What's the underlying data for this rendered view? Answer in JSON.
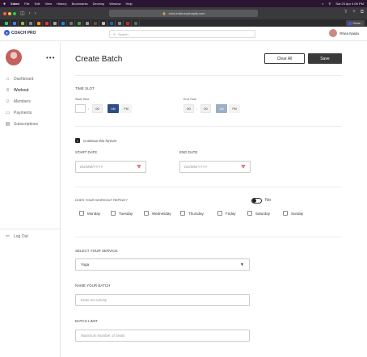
{
  "menubar": {
    "apple": "",
    "items": [
      "Safari",
      "File",
      "Edit",
      "View",
      "History",
      "Bookmarks",
      "Develop",
      "Window",
      "Help"
    ],
    "clock": "Sat 23 Apr  4:06 PM"
  },
  "browser": {
    "url": "shot-india.myshopify.com",
    "active_tab": "Home -",
    "colors": {
      "close": "#ff5f57",
      "min": "#febc2e",
      "max": "#28c840"
    }
  },
  "header": {
    "logo_text": "COACH PRO",
    "search_placeholder": "Search",
    "user_name": "Rhea Naidu"
  },
  "sidebar": {
    "menu_icon": "•••",
    "items": [
      {
        "label": "Dashboard",
        "icon": "home-icon",
        "glyph": "⌂"
      },
      {
        "label": "Workout",
        "icon": "workout-icon",
        "glyph": "≡"
      },
      {
        "label": "Members",
        "icon": "members-icon",
        "glyph": "☺"
      },
      {
        "label": "Payments",
        "icon": "payments-icon",
        "glyph": "▭"
      },
      {
        "label": "Subscriptions",
        "icon": "subscriptions-icon",
        "glyph": "▤"
      }
    ],
    "logout": {
      "label": "Log Out",
      "glyph": "⇦"
    }
  },
  "page": {
    "title": "Create Batch",
    "clear_label": "Clear All",
    "save_label": "Save"
  },
  "time_slot": {
    "heading": "TIME SLOT",
    "start": {
      "label": "Start Time",
      "hour": "",
      "minute": "00",
      "am": "AM",
      "pm": "PM"
    },
    "end": {
      "label": "End Time",
      "hour": "00",
      "minute": "00",
      "am": "AM",
      "pm": "PM"
    }
  },
  "continue_forever": {
    "label": "Continue this forever",
    "checked": true
  },
  "dates": {
    "start_label": "START DATE",
    "end_label": "END DATE",
    "placeholder": "DD/MM/YYYY"
  },
  "repeat": {
    "question": "DOES YOUR WORKOUT REPEAT?",
    "toggle_label": "No",
    "days": [
      "Monday",
      "Tuesday",
      "Wednesday",
      "Thursday",
      "Friday",
      "Saturday",
      "Sunday"
    ]
  },
  "service": {
    "label": "SELECT YOUR SERVICE",
    "selected": "Yoga"
  },
  "batch_name": {
    "label": "NAME YOUR BATCH",
    "placeholder": "Enter an activity"
  },
  "batch_limit": {
    "label": "BATCH LIMIT",
    "placeholder": "Maximum Number of Seats"
  }
}
